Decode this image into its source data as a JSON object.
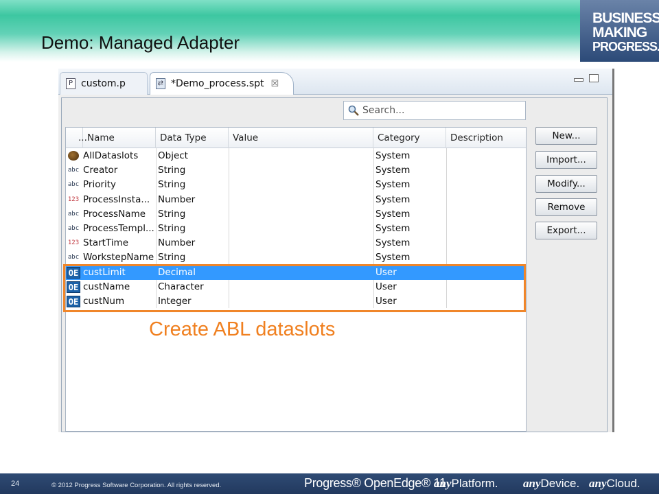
{
  "slide": {
    "title": "Demo: Managed Adapter",
    "brand_lines": [
      "BUSINESS",
      "MAKING",
      "PROGRESS."
    ],
    "callout": "Create ABL dataslots"
  },
  "tabs": [
    {
      "label": "custom.p",
      "icon": "progress-file-icon"
    },
    {
      "label": "*Demo_process.spt",
      "icon": "process-file-icon",
      "active": true
    }
  ],
  "search": {
    "placeholder": "Search..."
  },
  "table": {
    "columns": [
      "...",
      "Name",
      "Data Type",
      "Value",
      "Category",
      "Description"
    ],
    "rows": [
      {
        "icon": "object-icon",
        "name": "AllDataslots",
        "type": "Object",
        "value": "",
        "category": "System",
        "description": ""
      },
      {
        "icon": "abc",
        "name": "Creator",
        "type": "String",
        "value": "",
        "category": "System",
        "description": ""
      },
      {
        "icon": "abc",
        "name": "Priority",
        "type": "String",
        "value": "",
        "category": "System",
        "description": ""
      },
      {
        "icon": "123",
        "name": "ProcessInsta...",
        "type": "Number",
        "value": "",
        "category": "System",
        "description": ""
      },
      {
        "icon": "abc",
        "name": "ProcessName",
        "type": "String",
        "value": "",
        "category": "System",
        "description": ""
      },
      {
        "icon": "abc",
        "name": "ProcessTempl...",
        "type": "String",
        "value": "",
        "category": "System",
        "description": ""
      },
      {
        "icon": "123",
        "name": "StartTime",
        "type": "Number",
        "value": "",
        "category": "System",
        "description": ""
      },
      {
        "icon": "abc",
        "name": "WorkstepName",
        "type": "String",
        "value": "",
        "category": "System",
        "description": ""
      },
      {
        "icon": "OE",
        "name": "custLimit",
        "type": "Decimal",
        "value": "",
        "category": "User",
        "description": "",
        "selected": true
      },
      {
        "icon": "OE",
        "name": "custName",
        "type": "Character",
        "value": "",
        "category": "User",
        "description": ""
      },
      {
        "icon": "OE",
        "name": "custNum",
        "type": "Integer",
        "value": "",
        "category": "User",
        "description": ""
      }
    ]
  },
  "buttons": [
    "New...",
    "Import...",
    "Modify...",
    "Remove",
    "Export..."
  ],
  "footer": {
    "page_number": "24",
    "copyright": "© 2012 Progress Software Corporation. All rights reserved.",
    "product": "Progress® OpenEdge® 11",
    "tagline": [
      {
        "prefix": "any",
        "word": "Platform."
      },
      {
        "prefix": "any",
        "word": "Device."
      },
      {
        "prefix": "any",
        "word": "Cloud."
      }
    ]
  },
  "colors": {
    "highlight": "#f0862a",
    "selection": "#3399ff",
    "footer": "#2f4b74",
    "header": "#3dc7a1"
  }
}
